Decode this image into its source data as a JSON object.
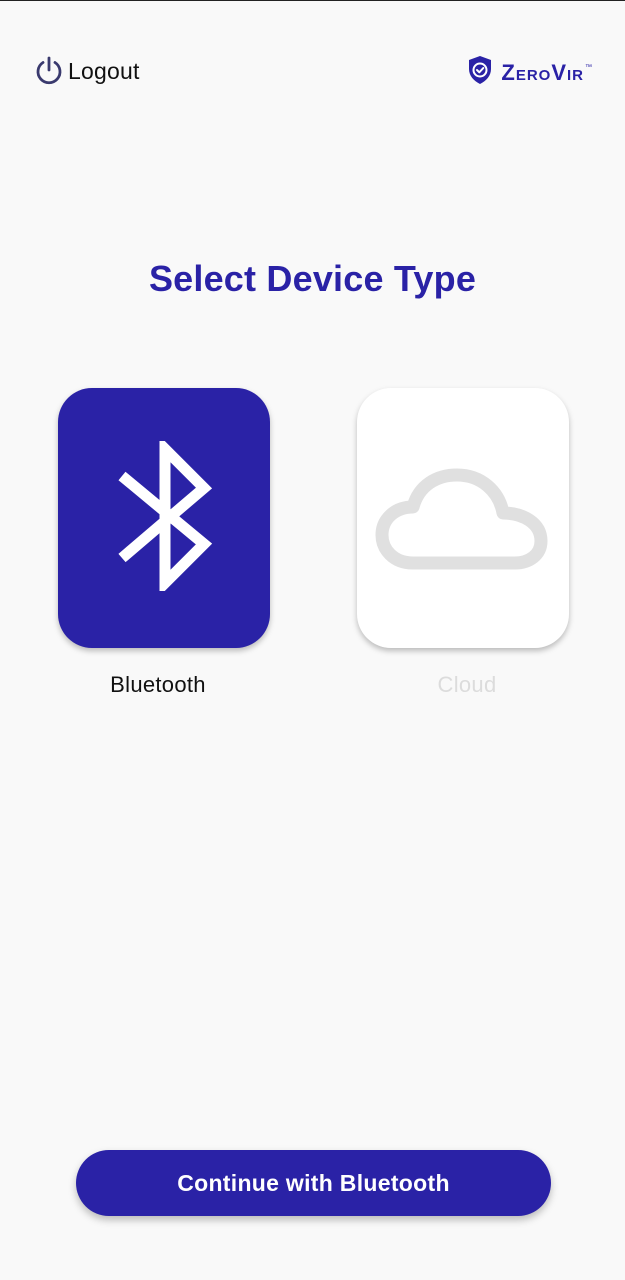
{
  "header": {
    "logout_label": "Logout",
    "logout_icon": "power-icon",
    "brand_name": "ZeroVir",
    "brand_tm": "™",
    "brand_icon": "shield-check-icon"
  },
  "main": {
    "title": "Select Device Type",
    "options": [
      {
        "label": "Bluetooth",
        "icon": "bluetooth-icon",
        "selected": true
      },
      {
        "label": "Cloud",
        "icon": "cloud-icon",
        "selected": false
      }
    ]
  },
  "footer": {
    "continue_label": "Continue with Bluetooth"
  },
  "colors": {
    "accent": "#2a22a6",
    "background": "#f9f9f9",
    "disabled_text": "#dcdcdc",
    "cloud_icon": "#e0e0e0"
  }
}
